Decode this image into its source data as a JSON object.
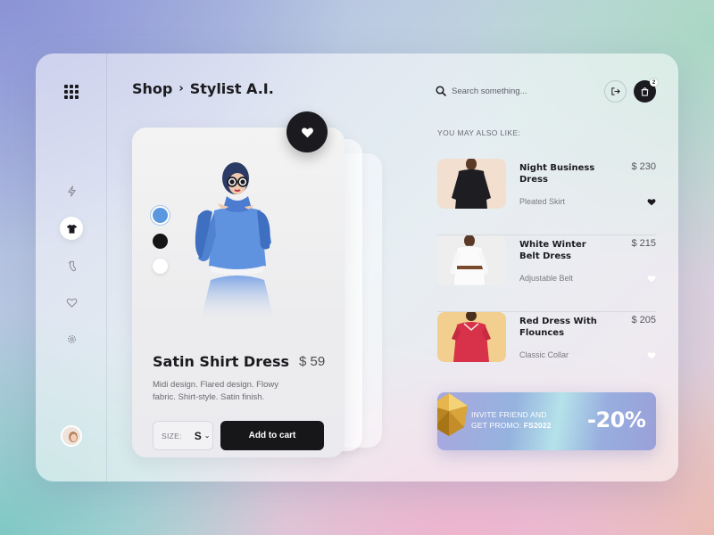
{
  "header": {
    "breadcrumb": {
      "root": "Shop",
      "separator": "›",
      "current": "Stylist A.I."
    },
    "search": {
      "placeholder": "Search something..."
    },
    "cart_count": "2"
  },
  "sidebar": {
    "items": [
      {
        "name": "lightning-icon",
        "active": false
      },
      {
        "name": "tshirt-icon",
        "active": true
      },
      {
        "name": "socks-icon",
        "active": false
      },
      {
        "name": "heart-icon",
        "active": false
      },
      {
        "name": "gear-icon",
        "active": false
      }
    ]
  },
  "product": {
    "name": "Satin Shirt Dress",
    "price": "$ 59",
    "description": "Midi design. Flared design. Flowy fabric. Shirt-style. Satin finish.",
    "colors": [
      "#5b97de",
      "#151517",
      "#ffffff"
    ],
    "size_label": "SIZE:",
    "size_value": "S",
    "add_to_cart": "Add to cart"
  },
  "recommendations": {
    "heading": "YOU MAY ALSO LIKE:",
    "items": [
      {
        "name": "Night Business Dress",
        "price": "$ 230",
        "subtitle": "Pleated Skirt",
        "liked": true
      },
      {
        "name": "White Winter Belt Dress",
        "price": "$ 215",
        "subtitle": "Adjustable Belt",
        "liked": false
      },
      {
        "name": "Red Dress With Flounces",
        "price": "$ 205",
        "subtitle": "Classic Collar",
        "liked": false
      }
    ]
  },
  "promo": {
    "line1": "INVITE FRIEND AND",
    "line2_prefix": "GET PROMO: ",
    "code": "FS2022",
    "discount": "-20%"
  },
  "colors": {
    "dark": "#1b1b1f",
    "accent_blue": "#5b97de",
    "red_dress": "#d8324a"
  }
}
